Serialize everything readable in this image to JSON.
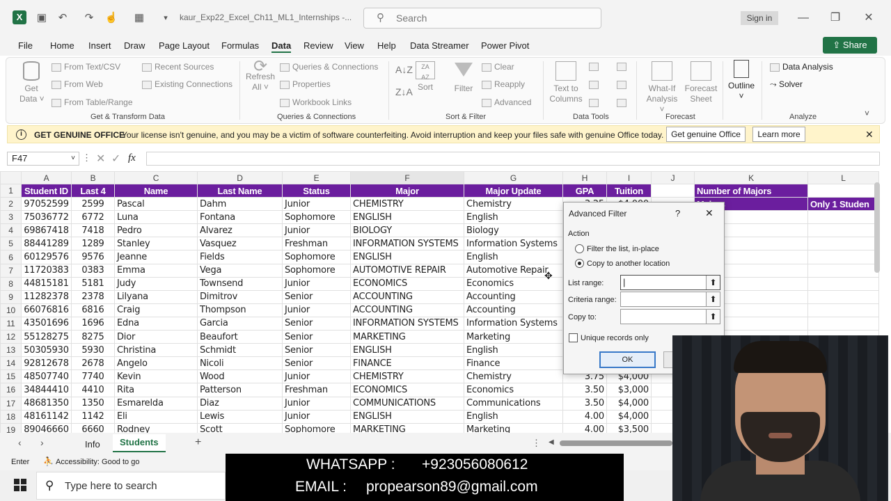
{
  "titlebar": {
    "filename": "kaur_Exp22_Excel_Ch11_ML1_Internships  -...",
    "search_placeholder": "Search",
    "signin": "Sign in"
  },
  "menu": [
    "File",
    "Home",
    "Insert",
    "Draw",
    "Page Layout",
    "Formulas",
    "Data",
    "Review",
    "View",
    "Help",
    "Data Streamer",
    "Power Pivot"
  ],
  "share_label": "Share",
  "ribbon": {
    "get_data": "Get\nData",
    "from_text": "From Text/CSV",
    "from_web": "From Web",
    "from_table": "From Table/Range",
    "recent_sources": "Recent Sources",
    "existing_connections": "Existing Connections",
    "group_get": "Get & Transform Data",
    "refresh_all": "Refresh\nAll",
    "queries_connections": "Queries & Connections",
    "properties": "Properties",
    "workbook_links": "Workbook Links",
    "group_queries": "Queries & Connections",
    "sort": "Sort",
    "filter": "Filter",
    "clear": "Clear",
    "reapply": "Reapply",
    "advanced": "Advanced",
    "group_sort": "Sort & Filter",
    "text_to_columns": "Text to\nColumns",
    "group_tools": "Data Tools",
    "what_if": "What-If\nAnalysis",
    "forecast_sheet": "Forecast\nSheet",
    "group_forecast": "Forecast",
    "outline": "Outline",
    "data_analysis": "Data Analysis",
    "solver": "Solver",
    "group_analyze": "Analyze"
  },
  "banner": {
    "title": "GET GENUINE OFFICE",
    "message": "Your license isn't genuine, and you may be a victim of software counterfeiting. Avoid interruption and keep your files safe with genuine Office today.",
    "get_button": "Get genuine Office",
    "learn_button": "Learn more"
  },
  "formula_bar": {
    "cell_ref": "F47",
    "fx": "fx"
  },
  "columns": [
    "A",
    "B",
    "C",
    "D",
    "E",
    "F",
    "G",
    "H",
    "I",
    "J",
    "K",
    "L"
  ],
  "headers": [
    "Student ID",
    "Last 4",
    "Name",
    "Last Name",
    "Status",
    "Major",
    "Major Update",
    "GPA",
    "Tuition"
  ],
  "side_headers": {
    "k1": "Number of Majors",
    "k2": "Majors",
    "l2": "Only 1 Studen"
  },
  "rows": [
    [
      "97052599",
      "2599",
      "Pascal",
      "Dahm",
      "Junior",
      "CHEMISTRY",
      "Chemistry",
      "3.25",
      "$4,000"
    ],
    [
      "75036772",
      "6772",
      "Luna",
      "Fontana",
      "Sophomore",
      "ENGLISH",
      "English",
      "",
      ""
    ],
    [
      "69867418",
      "7418",
      "Pedro",
      "Alvarez",
      "Junior",
      "BIOLOGY",
      "Biology",
      "",
      ""
    ],
    [
      "88441289",
      "1289",
      "Stanley",
      "Vasquez",
      "Freshman",
      "INFORMATION SYSTEMS",
      "Information Systems",
      "",
      ""
    ],
    [
      "60129576",
      "9576",
      "Jeanne",
      "Fields",
      "Sophomore",
      "ENGLISH",
      "English",
      "",
      ""
    ],
    [
      "11720383",
      "0383",
      "Emma",
      "Vega",
      "Sophomore",
      "AUTOMOTIVE REPAIR",
      "Automotive Repair",
      "",
      ""
    ],
    [
      "44815181",
      "5181",
      "Judy",
      "Townsend",
      "Junior",
      "ECONOMICS",
      "Economics",
      "",
      ""
    ],
    [
      "11282378",
      "2378",
      "Lilyana",
      "Dimitrov",
      "Senior",
      "ACCOUNTING",
      "Accounting",
      "",
      ""
    ],
    [
      "66076816",
      "6816",
      "Craig",
      "Thompson",
      "Junior",
      "ACCOUNTING",
      "Accounting",
      "",
      ""
    ],
    [
      "43501696",
      "1696",
      "Edna",
      "Garcia",
      "Senior",
      "INFORMATION SYSTEMS",
      "Information Systems",
      "",
      ""
    ],
    [
      "55128275",
      "8275",
      "Dior",
      "Beaufort",
      "Senior",
      "MARKETING",
      "Marketing",
      "",
      ""
    ],
    [
      "50305930",
      "5930",
      "Christina",
      "Schmidt",
      "Senior",
      "ENGLISH",
      "English",
      "",
      ""
    ],
    [
      "92812678",
      "2678",
      "Angelo",
      "Nicoli",
      "Senior",
      "FINANCE",
      "Finance",
      "",
      ""
    ],
    [
      "48507740",
      "7740",
      "Kevin",
      "Wood",
      "Junior",
      "CHEMISTRY",
      "Chemistry",
      "3.75",
      "$4,000"
    ],
    [
      "34844410",
      "4410",
      "Rita",
      "Patterson",
      "Freshman",
      "ECONOMICS",
      "Economics",
      "3.50",
      "$3,000"
    ],
    [
      "48681350",
      "1350",
      "Esmarelda",
      "Diaz",
      "Junior",
      "COMMUNICATIONS",
      "Communications",
      "3.50",
      "$4,000"
    ],
    [
      "48161142",
      "1142",
      "Eli",
      "Lewis",
      "Junior",
      "ENGLISH",
      "English",
      "4.00",
      "$4,000"
    ],
    [
      "89046660",
      "6660",
      "Rodney",
      "Scott",
      "Sophomore",
      "MARKETING",
      "Marketing",
      "4.00",
      "$3,500"
    ]
  ],
  "dialog": {
    "title": "Advanced Filter",
    "help": "?",
    "close": "✕",
    "action_label": "Action",
    "opt_inplace": "Filter the list, in-place",
    "opt_copy": "Copy to another location",
    "list_range": "List range:",
    "criteria_range": "Criteria range:",
    "copy_to": "Copy to:",
    "unique": "Unique records only",
    "ok": "OK"
  },
  "sheets": {
    "info": "Info",
    "students": "Students",
    "add": "+"
  },
  "status": {
    "mode": "Enter",
    "accessibility": "Accessibility: Good to go"
  },
  "taskbar": {
    "search": "Type here to search"
  },
  "overlay": {
    "whatsapp_label": "WHATSAPP :",
    "whatsapp": "+923056080612",
    "email_label": "EMAIL :",
    "email": "propearson89@gmail.com"
  },
  "colors": {
    "header_bg": "#6b1e9e",
    "excel_green": "#217346",
    "banner_bg": "#fff4cb"
  }
}
